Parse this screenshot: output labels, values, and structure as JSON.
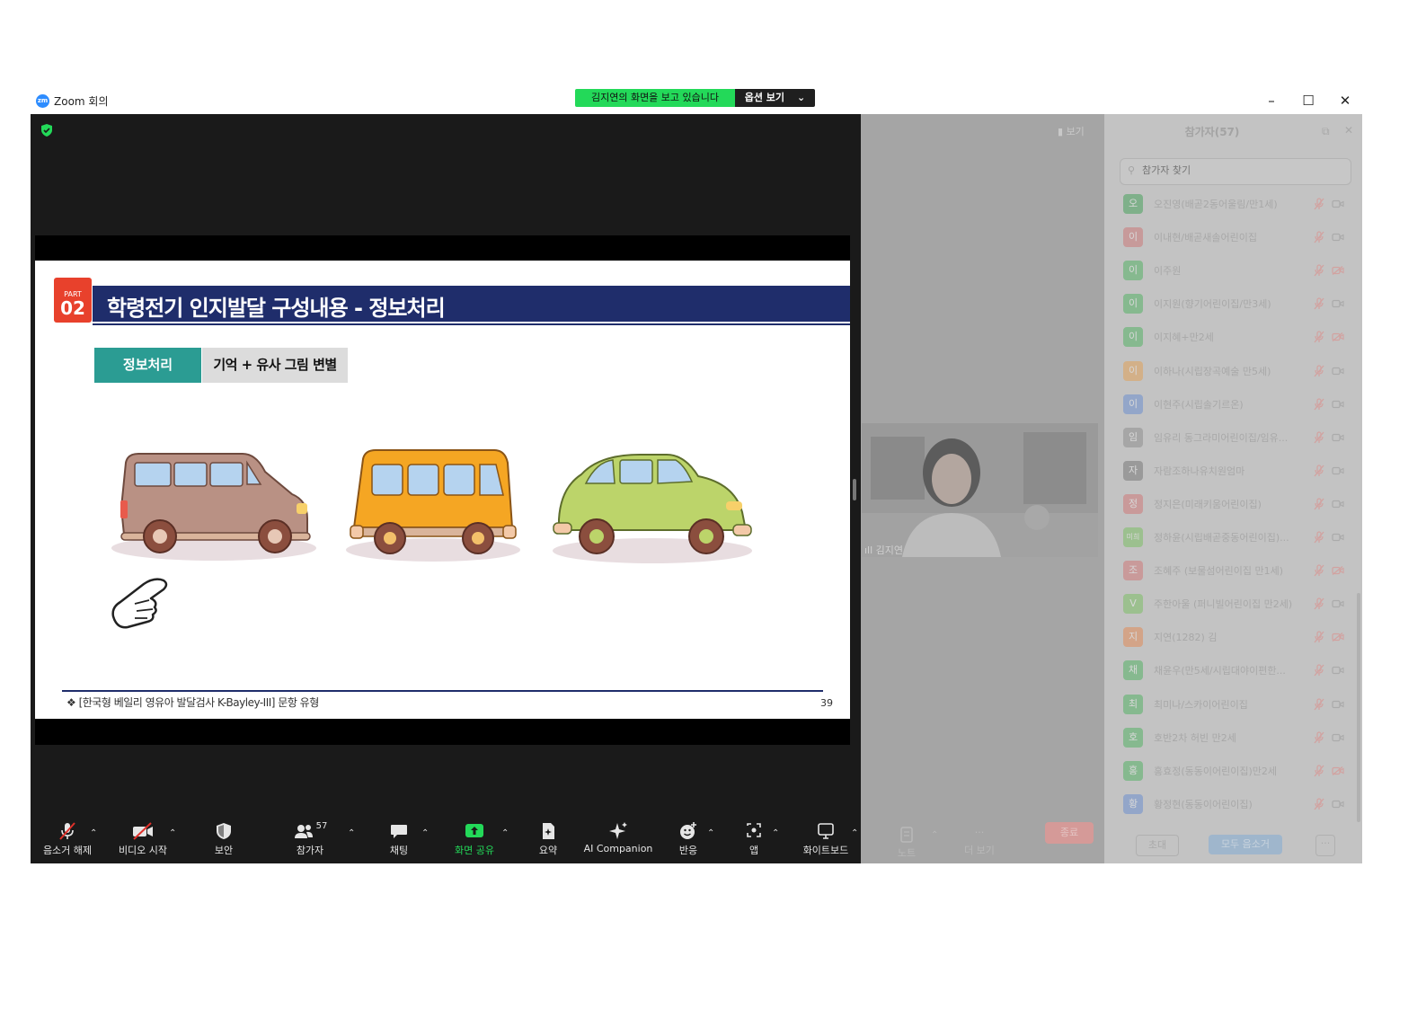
{
  "window": {
    "app_title": "Zoom 회의",
    "logo_text": "zm",
    "share_banner_text": "김지연의 화면을 보고 있습니다",
    "view_options_label": "옵션 보기"
  },
  "slide": {
    "part_label": "PART",
    "part_number": "02",
    "title": "학령전기 인지발달  구성내용 - 정보처리",
    "tag_primary": "정보처리",
    "tag_secondary": "기억 + 유사 그림 변별",
    "footer": "❖  [한국형 베일리 영유아 발달검사 K-Bayley-III] 문항 유형",
    "page_number": "39"
  },
  "toolbar": {
    "unmute": "음소거 해제",
    "start_video": "비디오 시작",
    "security": "보안",
    "participants": "참가자",
    "participants_count": "57",
    "chat": "채팅",
    "share_screen": "화면 공유",
    "summary": "요약",
    "ai_companion": "AI Companion",
    "reactions": "반응",
    "apps": "앱",
    "whiteboard": "화이트보드",
    "notes": "노트",
    "more": "더 보기",
    "end": "종료"
  },
  "gallery": {
    "view_label": "보기",
    "video_name": "김지연"
  },
  "panel": {
    "title": "참가자(57)",
    "search_placeholder": "참가자 찾기",
    "participants": [
      {
        "initial": "오",
        "name": "오진영(배곧2동어울림/만1세)",
        "color": "#7fb08a",
        "cam_off": false
      },
      {
        "initial": "이",
        "name": "이내현/배곧새솔어린이집",
        "color": "#c79a9a",
        "cam_off": false
      },
      {
        "initial": "이",
        "name": "이주원",
        "color": "#86b98f",
        "cam_off": true
      },
      {
        "initial": "이",
        "name": "이지원(향기어린이집/만3세)",
        "color": "#86b98f",
        "cam_off": false
      },
      {
        "initial": "이",
        "name": "이지혜+만2세",
        "color": "#86b98f",
        "cam_off": true
      },
      {
        "initial": "이",
        "name": "이하나(시립장곡예술 만5세)",
        "color": "#d3b088",
        "cam_off": false
      },
      {
        "initial": "이",
        "name": "이현주(시립솔기르온)",
        "color": "#93a6c9",
        "cam_off": false
      },
      {
        "initial": "임",
        "name": "임유리 동그라미어린이집/임유...",
        "color": "#a6a6a6",
        "cam_off": false
      },
      {
        "initial": "자",
        "name": "자람조하나유치원엄마",
        "color": "#9a9a9a",
        "cam_off": false
      },
      {
        "initial": "정",
        "name": "정지은(미래키움어린이집)",
        "color": "#c99a9a",
        "cam_off": false
      },
      {
        "initial": "미희",
        "name": "정하윤(시립배곧중동어린이집)...",
        "color": "#9cc08f",
        "cam_off": false
      },
      {
        "initial": "조",
        "name": "조혜주 (보물섬어린이집 만1세)",
        "color": "#c99a9a",
        "cam_off": true
      },
      {
        "initial": "V",
        "name": "주한아울 (퍼니빌어린이집 만2세)",
        "color": "#9cc08f",
        "cam_off": false
      },
      {
        "initial": "지",
        "name": "지연(1282) 김",
        "color": "#d3a488",
        "cam_off": true
      },
      {
        "initial": "채",
        "name": "채윤우(만5세/시립대야이편한...",
        "color": "#86b98f",
        "cam_off": false
      },
      {
        "initial": "최",
        "name": "최미나/스카이어린이집",
        "color": "#86b98f",
        "cam_off": false
      },
      {
        "initial": "호",
        "name": "호반2차 허빈 만2세",
        "color": "#86b98f",
        "cam_off": false
      },
      {
        "initial": "홍",
        "name": "홍효정(동동이어린이집)만2세",
        "color": "#86b98f",
        "cam_off": true
      },
      {
        "initial": "황",
        "name": "황정현(동동이어린이집)",
        "color": "#93a6c9",
        "cam_off": false
      }
    ],
    "invite_label": "초대",
    "mute_all_label": "모두 음소거",
    "more_label": "···"
  }
}
